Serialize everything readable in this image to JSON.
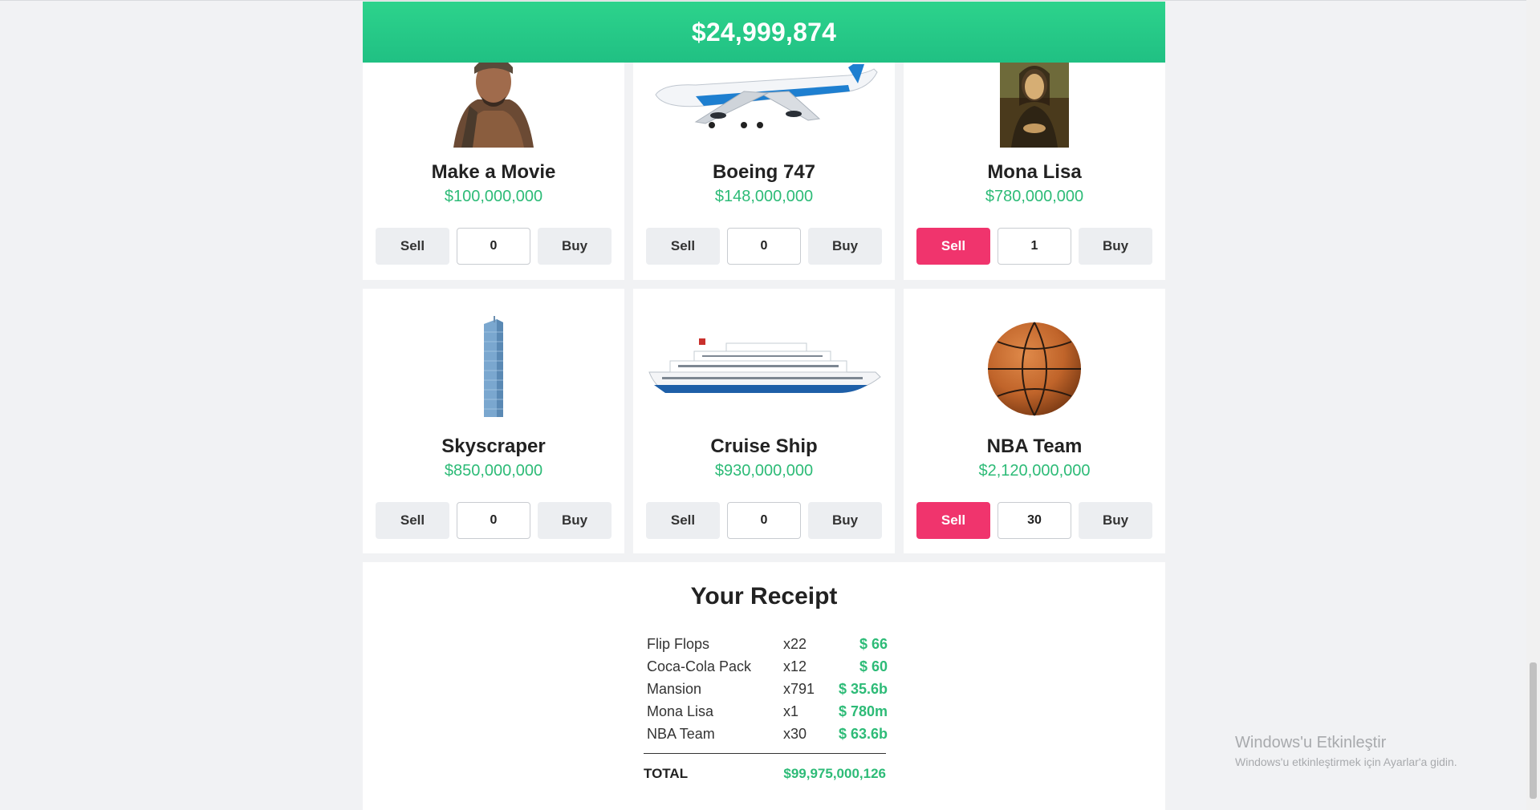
{
  "balance": "$24,999,874",
  "items": [
    {
      "name": "Make a Movie",
      "price": "$100,000,000",
      "qty": "0",
      "sell": "Sell",
      "buy": "Buy",
      "image": "movie-star-image"
    },
    {
      "name": "Boeing 747",
      "price": "$148,000,000",
      "qty": "0",
      "sell": "Sell",
      "buy": "Buy",
      "image": "airplane-image"
    },
    {
      "name": "Mona Lisa",
      "price": "$780,000,000",
      "qty": "1",
      "sell": "Sell",
      "buy": "Buy",
      "image": "mona-lisa-image"
    },
    {
      "name": "Skyscraper",
      "price": "$850,000,000",
      "qty": "0",
      "sell": "Sell",
      "buy": "Buy",
      "image": "skyscraper-image"
    },
    {
      "name": "Cruise Ship",
      "price": "$930,000,000",
      "qty": "0",
      "sell": "Sell",
      "buy": "Buy",
      "image": "cruise-ship-image"
    },
    {
      "name": "NBA Team",
      "price": "$2,120,000,000",
      "qty": "30",
      "sell": "Sell",
      "buy": "Buy",
      "image": "basketball-image"
    }
  ],
  "receipt": {
    "title": "Your Receipt",
    "rows": [
      {
        "name": "Flip Flops",
        "qty": "x22",
        "amount": "$ 66"
      },
      {
        "name": "Coca-Cola Pack",
        "qty": "x12",
        "amount": "$ 60"
      },
      {
        "name": "Mansion",
        "qty": "x791",
        "amount": "$ 35.6b"
      },
      {
        "name": "Mona Lisa",
        "qty": "x1",
        "amount": "$ 780m"
      },
      {
        "name": "NBA Team",
        "qty": "x30",
        "amount": "$ 63.6b"
      }
    ],
    "total_label": "TOTAL",
    "total_amount": "$99,975,000,126"
  },
  "watermark": {
    "title": "Windows'u Etkinleştir",
    "subtitle": "Windows'u etkinleştirmek için Ayarlar'a gidin."
  },
  "colors": {
    "accent_green": "#2dd38c",
    "sell_active": "#f0346d",
    "price_green": "#2dbb77"
  }
}
